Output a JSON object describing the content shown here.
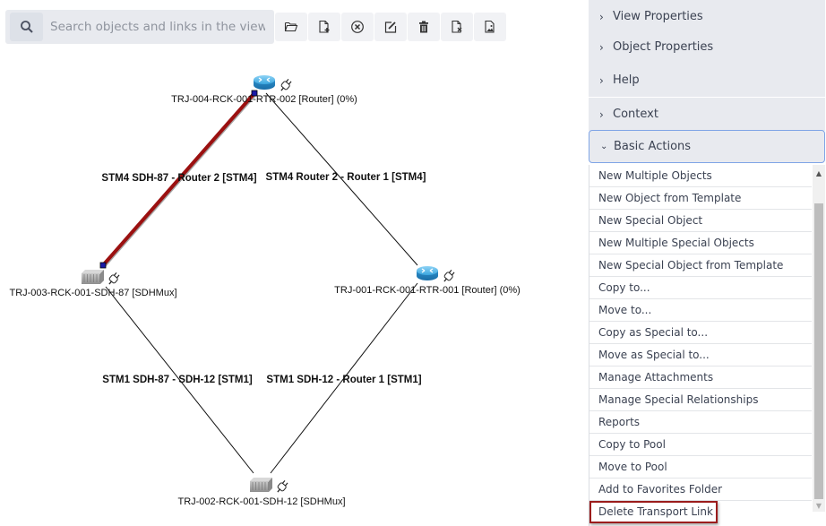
{
  "search": {
    "placeholder": "Search objects and links in the view",
    "icon": "search-icon"
  },
  "toolbar": {
    "buttons": [
      {
        "name": "open-folder-button",
        "icon": "folder-open-icon"
      },
      {
        "name": "new-document-button",
        "icon": "file-plus-icon"
      },
      {
        "name": "cancel-button",
        "icon": "circle-x-icon"
      },
      {
        "name": "edit-button",
        "icon": "edit-square-icon"
      },
      {
        "name": "delete-button",
        "icon": "trash-icon"
      },
      {
        "name": "remove-document-button",
        "icon": "file-x-icon"
      },
      {
        "name": "export-image-button",
        "icon": "file-image-icon"
      }
    ]
  },
  "diagram": {
    "nodes": [
      {
        "id": "router2",
        "type": "router",
        "label": "TRJ-004-RCK-001-RTR-002 [Router] (0%)"
      },
      {
        "id": "sdh87",
        "type": "sdhmux",
        "label": "TRJ-003-RCK-001-SDH-87 [SDHMux]"
      },
      {
        "id": "router1",
        "type": "router",
        "label": "TRJ-001-RCK-001-RTR-001 [Router] (0%)"
      },
      {
        "id": "sdh12",
        "type": "sdhmux",
        "label": "TRJ-002-RCK-001-SDH-12 [SDHMux]"
      }
    ],
    "links": [
      {
        "from": "sdh87",
        "to": "router2",
        "label": "STM4 SDH-87 - Router 2 [STM4]",
        "selected": true
      },
      {
        "from": "router2",
        "to": "router1",
        "label": "STM4 Router 2 - Router 1 [STM4]",
        "selected": false
      },
      {
        "from": "sdh87",
        "to": "sdh12",
        "label": "STM1 SDH-87 - SDH-12 [STM1]",
        "selected": false
      },
      {
        "from": "sdh12",
        "to": "router1",
        "label": "STM1 SDH-12 - Router 1 [STM1]",
        "selected": false
      }
    ],
    "selected_link_color": "#9b1010"
  },
  "panel": {
    "sections": [
      {
        "label": "View Properties",
        "expanded": false
      },
      {
        "label": "Object Properties",
        "expanded": false
      },
      {
        "label": "Help",
        "expanded": false
      },
      {
        "label": "Context",
        "expanded": false
      },
      {
        "label": "Basic Actions",
        "expanded": true
      }
    ],
    "actions": [
      "New Multiple Objects",
      "New Object from Template",
      "New Special Object",
      "New Multiple Special Objects",
      "New Special Object from Template",
      "Copy to...",
      "Move to...",
      "Copy as Special to...",
      "Move as Special to...",
      "Manage Attachments",
      "Manage Special Relationships",
      "Reports",
      "Copy to Pool",
      "Move to Pool",
      "Add to Favorites Folder",
      "Delete Transport Link"
    ],
    "highlighted_action": "Delete Transport Link"
  }
}
